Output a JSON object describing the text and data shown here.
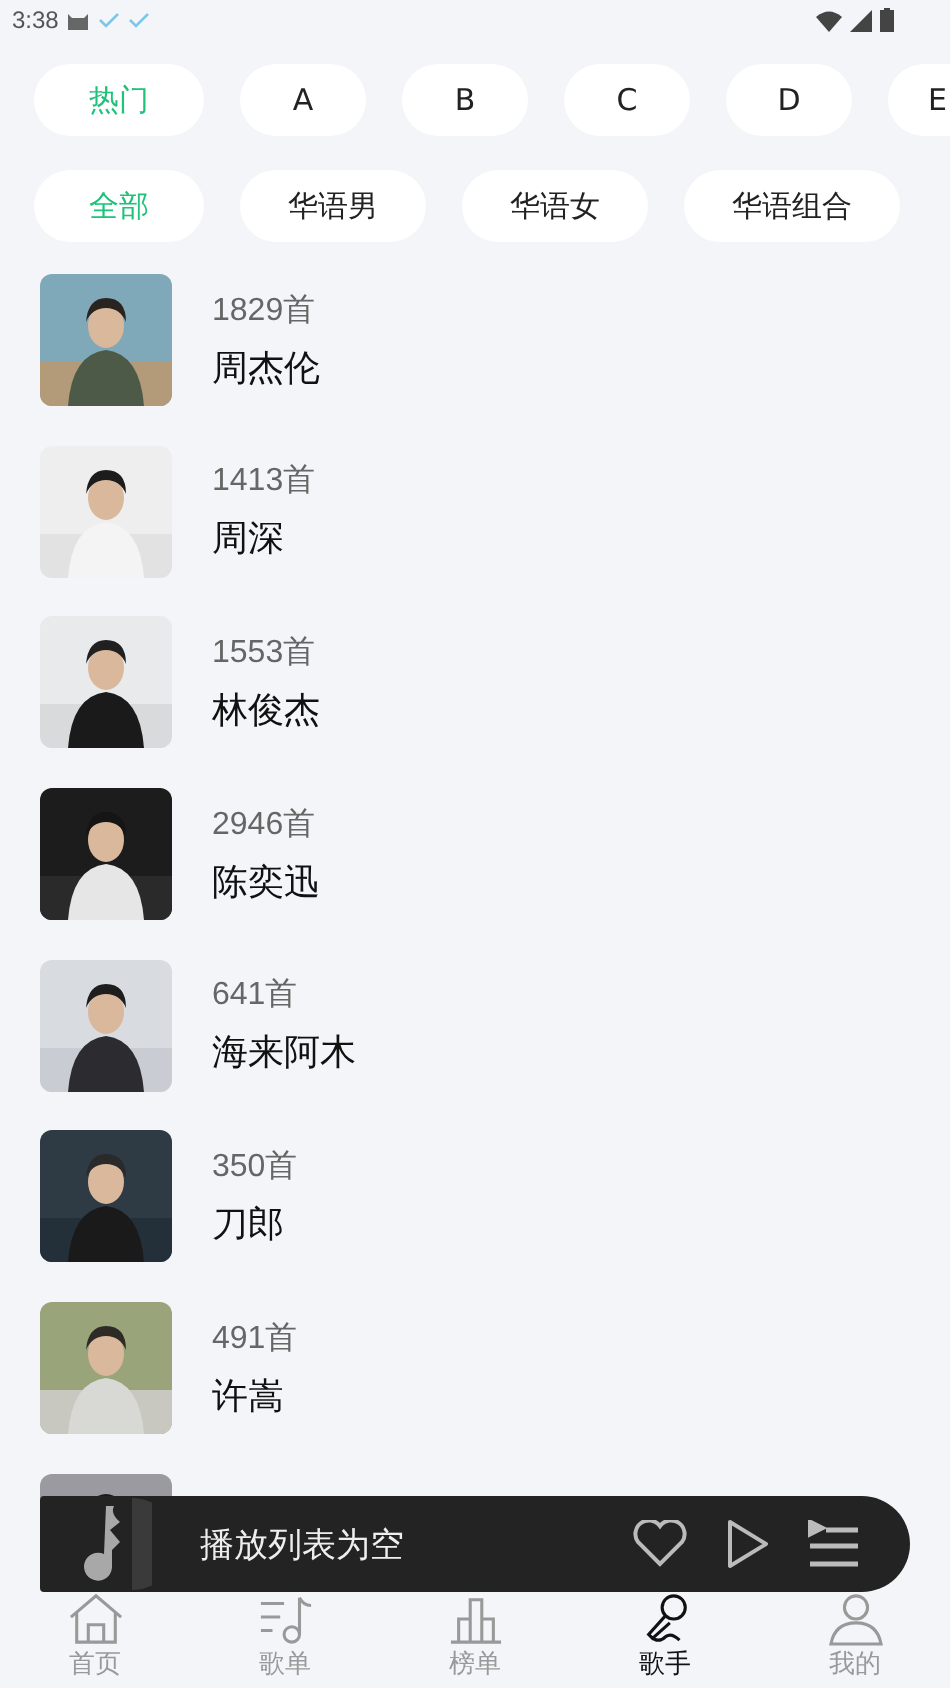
{
  "status_bar": {
    "time": "3:38"
  },
  "letter_tabs": [
    {
      "label": "热门",
      "selected": true
    },
    {
      "label": "A",
      "selected": false
    },
    {
      "label": "B",
      "selected": false
    },
    {
      "label": "C",
      "selected": false
    },
    {
      "label": "D",
      "selected": false
    },
    {
      "label": "E",
      "selected": false
    }
  ],
  "category_tabs": [
    {
      "label": "全部",
      "selected": true
    },
    {
      "label": "华语男",
      "selected": false
    },
    {
      "label": "华语女",
      "selected": false
    },
    {
      "label": "华语组合",
      "selected": false
    }
  ],
  "singers": [
    {
      "count": "1829首",
      "name": "周杰伦"
    },
    {
      "count": "1413首",
      "name": "周深"
    },
    {
      "count": "1553首",
      "name": "林俊杰"
    },
    {
      "count": "2946首",
      "name": "陈奕迅"
    },
    {
      "count": "641首",
      "name": "海来阿木"
    },
    {
      "count": "350首",
      "name": "刀郎"
    },
    {
      "count": "491首",
      "name": "许嵩"
    }
  ],
  "player": {
    "title": "播放列表为空"
  },
  "bottom_nav": [
    {
      "label": "首页",
      "selected": false
    },
    {
      "label": "歌单",
      "selected": false
    },
    {
      "label": "榜单",
      "selected": false
    },
    {
      "label": "歌手",
      "selected": true
    },
    {
      "label": "我的",
      "selected": false
    }
  ]
}
